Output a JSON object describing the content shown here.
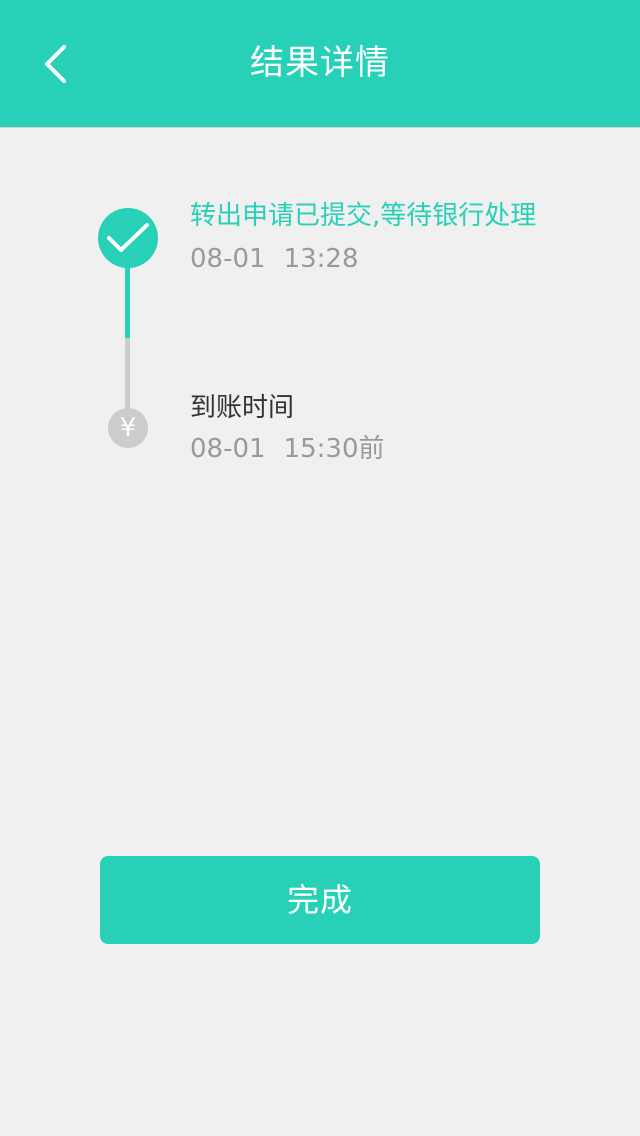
{
  "header": {
    "title": "结果详情",
    "back_icon": "chevron-left-icon"
  },
  "timeline": {
    "steps": [
      {
        "title": "转出申请已提交,等待银行处理",
        "date": "08-01",
        "time": "13:28",
        "status": "done",
        "icon": "check-icon"
      },
      {
        "title": "到账时间",
        "date": "08-01",
        "time": "15:30前",
        "status": "pending",
        "icon": "yuan-icon",
        "icon_glyph": "¥"
      }
    ]
  },
  "actions": {
    "done_label": "完成"
  },
  "colors": {
    "accent": "#27d0b7",
    "background": "#f0f0f0",
    "pending": "#cccccc",
    "muted_text": "#999999",
    "dark_text": "#333333"
  }
}
